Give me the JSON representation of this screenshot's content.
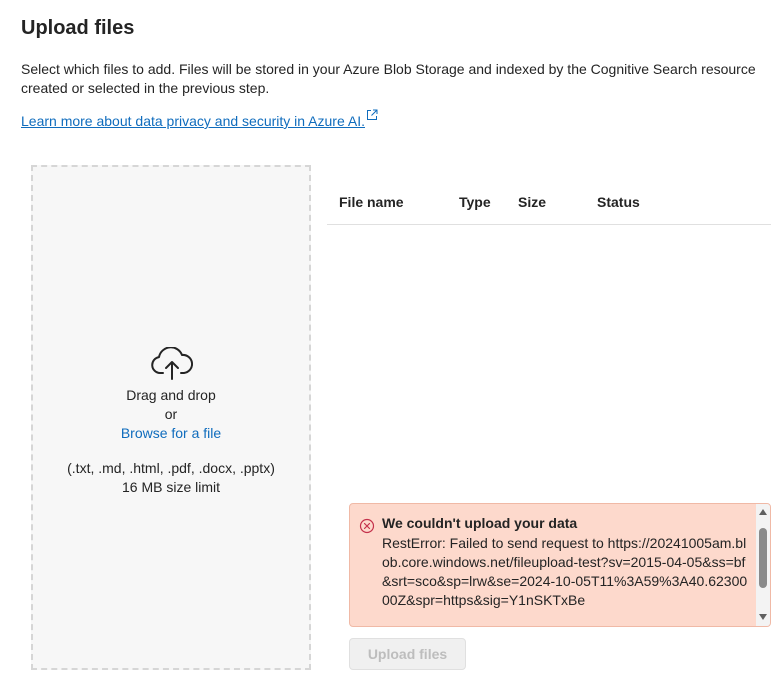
{
  "header": {
    "title": "Upload files",
    "description": "Select which files to add. Files will be stored in your Azure Blob Storage and indexed by the Cognitive Search resource created or selected in the previous step.",
    "learn_more_link": "Learn more about data privacy and security in Azure AI."
  },
  "dropzone": {
    "drag_text": "Drag and drop",
    "or_text": "or",
    "browse_link": "Browse for a file",
    "file_types": "(.txt, .md, .html, .pdf, .docx, .pptx)",
    "size_limit": "16 MB size limit",
    "icon": "cloud-upload-icon"
  },
  "table": {
    "columns": [
      "File name",
      "Type",
      "Size",
      "Status"
    ],
    "rows": []
  },
  "error": {
    "title": "We couldn't upload your data",
    "message": "RestError: Failed to send request to https://20241005am.blob.core.windows.net/fileupload-test?sv=2015-04-05&ss=bf&srt=sco&sp=lrw&se=2024-10-05T11%3A59%3A40.6230000Z&spr=https&sig=Y1nSKTxBe",
    "icon": "error-circle-icon",
    "colors": {
      "background": "#fdd9cc",
      "icon": "#c4314b"
    }
  },
  "actions": {
    "upload_label": "Upload files"
  },
  "colors": {
    "link": "#0f6cbd",
    "text": "#242424"
  }
}
